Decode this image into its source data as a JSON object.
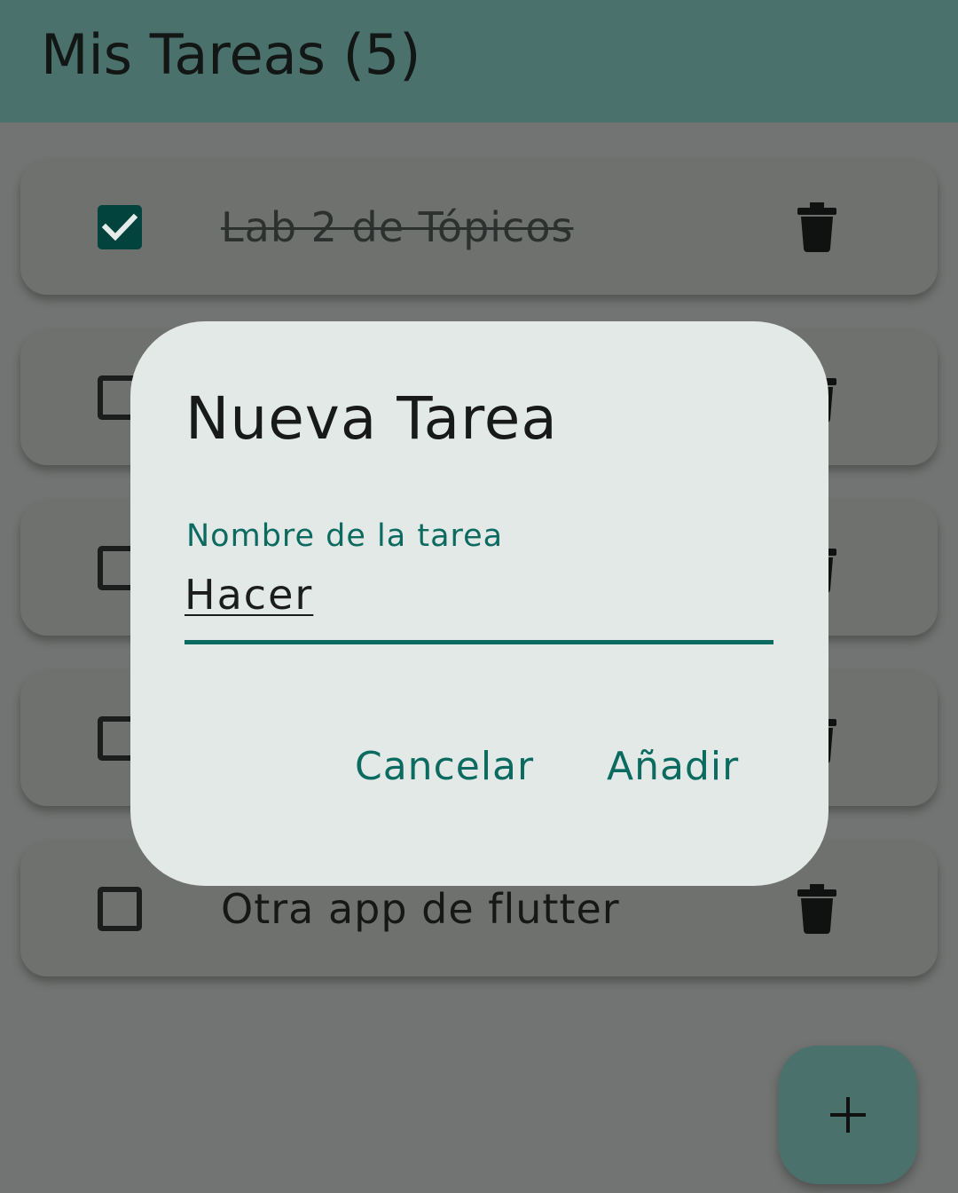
{
  "appbar": {
    "title": "Mis Tareas (5)"
  },
  "tasks": [
    {
      "label": "Lab 2 de Tópicos",
      "checked": true
    },
    {
      "label": "",
      "checked": false
    },
    {
      "label": "",
      "checked": false
    },
    {
      "label": "",
      "checked": false
    },
    {
      "label": "Otra app de flutter",
      "checked": false
    }
  ],
  "dialog": {
    "title": "Nueva Tarea",
    "field_label": "Nombre de la tarea",
    "field_value": "Hacer",
    "cancel_label": "Cancelar",
    "add_label": "Añadir"
  },
  "fab": {
    "icon": "plus-icon"
  },
  "colors": {
    "primary": "#4a716b",
    "accent": "#0c6b61",
    "checked_box": "#03433d",
    "dialog_bg": "#e3e9e7"
  }
}
